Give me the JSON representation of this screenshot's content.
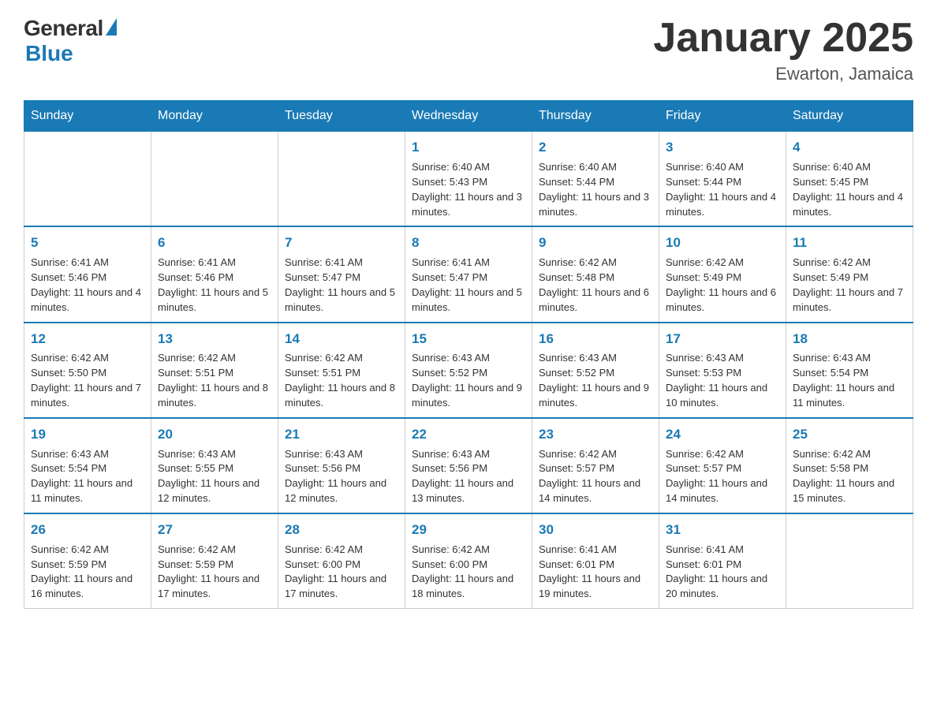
{
  "logo": {
    "general": "General",
    "blue": "Blue"
  },
  "title": "January 2025",
  "subtitle": "Ewarton, Jamaica",
  "header": {
    "days": [
      "Sunday",
      "Monday",
      "Tuesday",
      "Wednesday",
      "Thursday",
      "Friday",
      "Saturday"
    ]
  },
  "weeks": [
    [
      {
        "day": "",
        "info": ""
      },
      {
        "day": "",
        "info": ""
      },
      {
        "day": "",
        "info": ""
      },
      {
        "day": "1",
        "info": "Sunrise: 6:40 AM\nSunset: 5:43 PM\nDaylight: 11 hours and 3 minutes."
      },
      {
        "day": "2",
        "info": "Sunrise: 6:40 AM\nSunset: 5:44 PM\nDaylight: 11 hours and 3 minutes."
      },
      {
        "day": "3",
        "info": "Sunrise: 6:40 AM\nSunset: 5:44 PM\nDaylight: 11 hours and 4 minutes."
      },
      {
        "day": "4",
        "info": "Sunrise: 6:40 AM\nSunset: 5:45 PM\nDaylight: 11 hours and 4 minutes."
      }
    ],
    [
      {
        "day": "5",
        "info": "Sunrise: 6:41 AM\nSunset: 5:46 PM\nDaylight: 11 hours and 4 minutes."
      },
      {
        "day": "6",
        "info": "Sunrise: 6:41 AM\nSunset: 5:46 PM\nDaylight: 11 hours and 5 minutes."
      },
      {
        "day": "7",
        "info": "Sunrise: 6:41 AM\nSunset: 5:47 PM\nDaylight: 11 hours and 5 minutes."
      },
      {
        "day": "8",
        "info": "Sunrise: 6:41 AM\nSunset: 5:47 PM\nDaylight: 11 hours and 5 minutes."
      },
      {
        "day": "9",
        "info": "Sunrise: 6:42 AM\nSunset: 5:48 PM\nDaylight: 11 hours and 6 minutes."
      },
      {
        "day": "10",
        "info": "Sunrise: 6:42 AM\nSunset: 5:49 PM\nDaylight: 11 hours and 6 minutes."
      },
      {
        "day": "11",
        "info": "Sunrise: 6:42 AM\nSunset: 5:49 PM\nDaylight: 11 hours and 7 minutes."
      }
    ],
    [
      {
        "day": "12",
        "info": "Sunrise: 6:42 AM\nSunset: 5:50 PM\nDaylight: 11 hours and 7 minutes."
      },
      {
        "day": "13",
        "info": "Sunrise: 6:42 AM\nSunset: 5:51 PM\nDaylight: 11 hours and 8 minutes."
      },
      {
        "day": "14",
        "info": "Sunrise: 6:42 AM\nSunset: 5:51 PM\nDaylight: 11 hours and 8 minutes."
      },
      {
        "day": "15",
        "info": "Sunrise: 6:43 AM\nSunset: 5:52 PM\nDaylight: 11 hours and 9 minutes."
      },
      {
        "day": "16",
        "info": "Sunrise: 6:43 AM\nSunset: 5:52 PM\nDaylight: 11 hours and 9 minutes."
      },
      {
        "day": "17",
        "info": "Sunrise: 6:43 AM\nSunset: 5:53 PM\nDaylight: 11 hours and 10 minutes."
      },
      {
        "day": "18",
        "info": "Sunrise: 6:43 AM\nSunset: 5:54 PM\nDaylight: 11 hours and 11 minutes."
      }
    ],
    [
      {
        "day": "19",
        "info": "Sunrise: 6:43 AM\nSunset: 5:54 PM\nDaylight: 11 hours and 11 minutes."
      },
      {
        "day": "20",
        "info": "Sunrise: 6:43 AM\nSunset: 5:55 PM\nDaylight: 11 hours and 12 minutes."
      },
      {
        "day": "21",
        "info": "Sunrise: 6:43 AM\nSunset: 5:56 PM\nDaylight: 11 hours and 12 minutes."
      },
      {
        "day": "22",
        "info": "Sunrise: 6:43 AM\nSunset: 5:56 PM\nDaylight: 11 hours and 13 minutes."
      },
      {
        "day": "23",
        "info": "Sunrise: 6:42 AM\nSunset: 5:57 PM\nDaylight: 11 hours and 14 minutes."
      },
      {
        "day": "24",
        "info": "Sunrise: 6:42 AM\nSunset: 5:57 PM\nDaylight: 11 hours and 14 minutes."
      },
      {
        "day": "25",
        "info": "Sunrise: 6:42 AM\nSunset: 5:58 PM\nDaylight: 11 hours and 15 minutes."
      }
    ],
    [
      {
        "day": "26",
        "info": "Sunrise: 6:42 AM\nSunset: 5:59 PM\nDaylight: 11 hours and 16 minutes."
      },
      {
        "day": "27",
        "info": "Sunrise: 6:42 AM\nSunset: 5:59 PM\nDaylight: 11 hours and 17 minutes."
      },
      {
        "day": "28",
        "info": "Sunrise: 6:42 AM\nSunset: 6:00 PM\nDaylight: 11 hours and 17 minutes."
      },
      {
        "day": "29",
        "info": "Sunrise: 6:42 AM\nSunset: 6:00 PM\nDaylight: 11 hours and 18 minutes."
      },
      {
        "day": "30",
        "info": "Sunrise: 6:41 AM\nSunset: 6:01 PM\nDaylight: 11 hours and 19 minutes."
      },
      {
        "day": "31",
        "info": "Sunrise: 6:41 AM\nSunset: 6:01 PM\nDaylight: 11 hours and 20 minutes."
      },
      {
        "day": "",
        "info": ""
      }
    ]
  ]
}
